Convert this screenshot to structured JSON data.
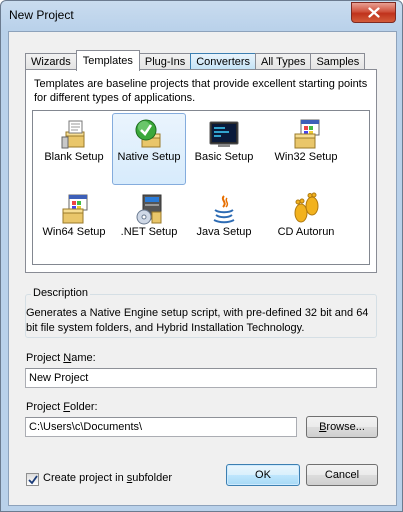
{
  "window": {
    "title": "New Project",
    "close_icon": "close-x-icon"
  },
  "tabs": [
    {
      "label": "Wizards",
      "active": false
    },
    {
      "label": "Templates",
      "active": true
    },
    {
      "label": "Plug-Ins",
      "active": false
    },
    {
      "label": "Converters",
      "active": false
    },
    {
      "label": "All Types",
      "active": false
    },
    {
      "label": "Samples",
      "active": false
    }
  ],
  "templates_panel": {
    "description": "Templates are baseline projects that provide excellent starting points for different types of applications.",
    "items": [
      {
        "label": "Blank Setup",
        "icon": "blank-setup-icon",
        "selected": false
      },
      {
        "label": "Native Setup",
        "icon": "native-setup-icon",
        "selected": true
      },
      {
        "label": "Basic Setup",
        "icon": "basic-setup-icon",
        "selected": false
      },
      {
        "label": "Win32 Setup",
        "icon": "win32-setup-icon",
        "selected": false
      },
      {
        "label": "Win64 Setup",
        "icon": "win64-setup-icon",
        "selected": false
      },
      {
        "label": ".NET Setup",
        "icon": "dotnet-setup-icon",
        "selected": false
      },
      {
        "label": "Java Setup",
        "icon": "java-setup-icon",
        "selected": false
      },
      {
        "label": "CD Autorun",
        "icon": "cd-autorun-icon",
        "selected": false
      }
    ]
  },
  "description_group": {
    "legend": "Description",
    "text": "Generates a Native Engine setup script, with pre-defined 32 bit and 64 bit file system folders, and Hybrid Installation Technology."
  },
  "project_name": {
    "label_prefix": "Project ",
    "label_mnemonic": "N",
    "label_suffix": "ame:",
    "value": "New Project"
  },
  "project_folder": {
    "label_prefix": "Project ",
    "label_mnemonic": "F",
    "label_suffix": "older:",
    "value": "C:\\Users\\c\\Documents\\"
  },
  "browse_button": {
    "mnemonic": "B",
    "rest": "rowse..."
  },
  "subfolder_checkbox": {
    "label_prefix": "Create project in ",
    "label_mnemonic": "s",
    "label_suffix": "ubfolder",
    "checked": true
  },
  "buttons": {
    "ok": "OK",
    "cancel": "Cancel"
  },
  "colors": {
    "selection_border": "#84acdd",
    "default_button_border": "#3c7fb1",
    "close_button": "#c0321c"
  }
}
